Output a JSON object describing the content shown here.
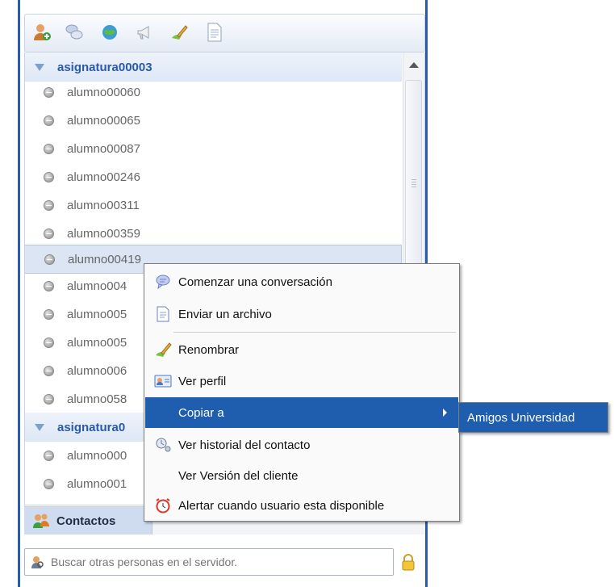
{
  "toolbar": {
    "icons": [
      "add-contact-icon",
      "chat-icon",
      "globe-icon",
      "megaphone-icon",
      "rename-icon",
      "document-icon"
    ]
  },
  "groups": [
    {
      "name": "asignatura00003",
      "contacts": [
        "alumno00060",
        "alumno00065",
        "alumno00087",
        "alumno00246",
        "alumno00311",
        "alumno00359",
        "alumno00419",
        "alumno004",
        "alumno005",
        "alumno005",
        "alumno006",
        "alumno058"
      ]
    },
    {
      "name": "asignatura0",
      "contacts": [
        "alumno000",
        "alumno001"
      ]
    }
  ],
  "selected_contact": "alumno00419",
  "tabs": {
    "contacts": "Contactos"
  },
  "search": {
    "placeholder": "Buscar otras personas en el servidor."
  },
  "context_menu": {
    "items": [
      {
        "label": "Comenzar una conversación",
        "icon": "chat-bubble-icon"
      },
      {
        "label": "Enviar un archivo",
        "icon": "file-icon"
      },
      {
        "label": "Renombrar",
        "icon": "rename-icon"
      },
      {
        "label": "Ver perfil",
        "icon": "profile-icon"
      },
      {
        "label": "Copiar a",
        "icon": ""
      },
      {
        "label": "Ver historial del contacto",
        "icon": "history-icon"
      },
      {
        "label": "Ver Versión del cliente",
        "icon": ""
      },
      {
        "label": "Alertar cuando usuario esta disponible",
        "icon": "alarm-clock-icon"
      }
    ],
    "submenu": {
      "label": "Amigos Universidad"
    }
  },
  "colors": {
    "accent": "#1f5eae",
    "border": "#2a5caa",
    "group_text": "#2b5aa8"
  }
}
